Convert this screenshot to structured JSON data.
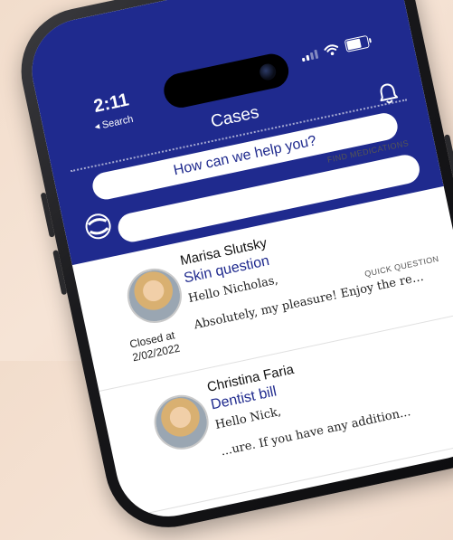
{
  "status_bar": {
    "time": "2:11",
    "back_label": "◂ Search"
  },
  "header": {
    "title": "Cases",
    "help_prompt": "How can we help you?",
    "find_medications": "FIND MEDICATIONS"
  },
  "icons": {
    "bell": "bell-icon",
    "logo": "brand-logo-icon",
    "wifi": "wifi-icon",
    "battery": "battery-icon",
    "signal": "signal-icon"
  },
  "colors": {
    "header_bg": "#1f2a8e",
    "accent": "#1f2a8e"
  },
  "cases": [
    {
      "name": "Marisa Slutsky",
      "subject": "Skin question",
      "greeting": "Hello Nicholas,",
      "preview": "Absolutely, my pleasure! Enjoy the rest of yo...",
      "status": "Closed at",
      "date": "2/02/2022",
      "tag": "QUICK QUESTION"
    },
    {
      "name": "Christina Faria",
      "subject": "Dentist bill",
      "greeting": "Hello Nick,",
      "preview": "...ure. If you have any addition...",
      "status": "",
      "date": "",
      "tag": ""
    }
  ]
}
